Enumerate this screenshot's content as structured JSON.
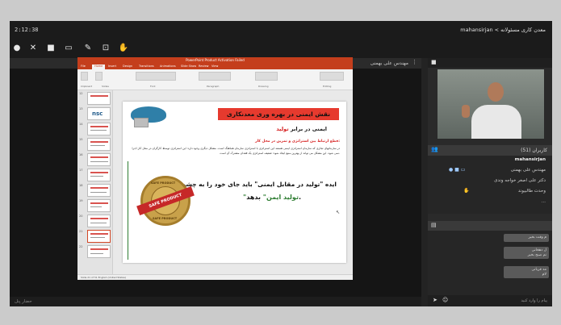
{
  "session": {
    "time": "2:12:38",
    "breadcrumb": "mahansirjan < معدن کاری مسئولانه"
  },
  "presenter": {
    "name": "مهندس علی بهمنی"
  },
  "powerpoint": {
    "title_bar": "PowerPoint Product Activation Failed",
    "tabs": [
      "File",
      "Home",
      "Insert",
      "Design",
      "Transitions",
      "Animations",
      "Slide Show",
      "Review",
      "View"
    ],
    "ribbon_groups": [
      "Clipboard",
      "Slides",
      "Font",
      "Paragraph",
      "Drawing",
      "Editing"
    ],
    "slide_numbers": [
      "12",
      "13",
      "14",
      "15",
      "16",
      "17",
      "18",
      "19",
      "20",
      "21",
      "22"
    ],
    "thumb_logo": "nsc",
    "status": "Slide 21 of 51  English (United States)"
  },
  "slide": {
    "heading": "نقش ایمنی در بهره وری معدنکاری",
    "sub_black": "ایمنی در برابر ",
    "sub_red": "تولید",
    "red_line": "قطع ارتباط بین استراتژی و تمرین در محل کار:",
    "paragraph": "در سازمانهای تجاری که سازمان استراتژی ایمنی هستند این استراتژی با استراتژی سازمان هماهنگ است. مشکل دیگری وجود دارد: این استراتژی توسط کارگران در محل کار اجرا نمی شود. این مشکل می تواند از بهترین منبع ایجاد شود: ضعیف استراتژی یک فقدان مشترک آن است.",
    "quote_line1": "ایده \"تولید در مقابل ایمنی\" باید جای خود را به چشم انداز",
    "quote_line2_green": "\"تولید ایمن\"",
    "quote_line2_black": " بدهد.",
    "badge_text": "SAFE PRODUCT",
    "badge_ring_top": "SAFE PRODUCT",
    "badge_ring_bottom": "SAFE PRODUCT"
  },
  "participants": {
    "header": "کاربران (51)",
    "items": [
      {
        "name": "mahansirjan",
        "me": true
      },
      {
        "name": "مهندس علی بهمنی"
      },
      {
        "name": "دکتر علی اصغر خواجه وندی"
      },
      {
        "name": "وحدت طالبیوند"
      },
      {
        "name": "..."
      }
    ]
  },
  "chat": {
    "messages": [
      {
        "line1": "م وقت بخیر"
      },
      {
        "line1": "ل دهخانی",
        "line2": "نم صبح بخیر"
      },
      {
        "line1": "مد قربانی",
        "line2": "لام"
      }
    ],
    "placeholder": "پیام را وارد کنید"
  },
  "bottombar": {
    "text": "حضار پنل"
  },
  "colors": {
    "ppt_accent": "#c43e1c",
    "banner_red": "#e63a2e",
    "safe_green": "#2e7d32"
  }
}
